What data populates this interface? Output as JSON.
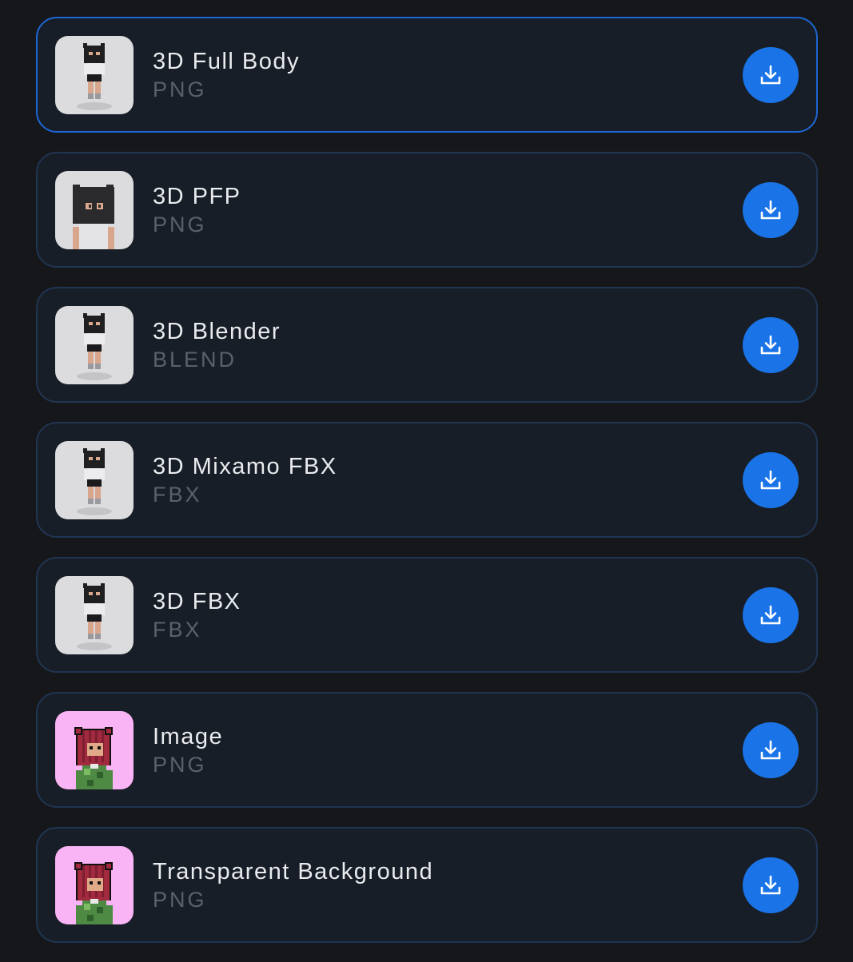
{
  "items": [
    {
      "title": "3D Full Body",
      "format": "PNG",
      "thumb": "3d-full-body",
      "selected": true
    },
    {
      "title": "3D PFP",
      "format": "PNG",
      "thumb": "3d-pfp",
      "selected": false
    },
    {
      "title": "3D Blender",
      "format": "BLEND",
      "thumb": "3d-full-body",
      "selected": false
    },
    {
      "title": "3D Mixamo FBX",
      "format": "FBX",
      "thumb": "3d-full-body",
      "selected": false
    },
    {
      "title": "3D FBX",
      "format": "FBX",
      "thumb": "3d-full-body",
      "selected": false
    },
    {
      "title": "Image",
      "format": "PNG",
      "thumb": "pixel-art",
      "selected": false
    },
    {
      "title": "Transparent Background",
      "format": "PNG",
      "thumb": "pixel-art",
      "selected": false
    }
  ],
  "download_icon": "download-icon",
  "colors": {
    "background": "#16171a",
    "card": "#181e27",
    "card_border": "#1f3552",
    "selected_border": "#1d67d4",
    "accent": "#1a74e8",
    "title_text": "#e9ebee",
    "format_text": "#5b616b",
    "pixel_bg": "#f8b4f4"
  }
}
